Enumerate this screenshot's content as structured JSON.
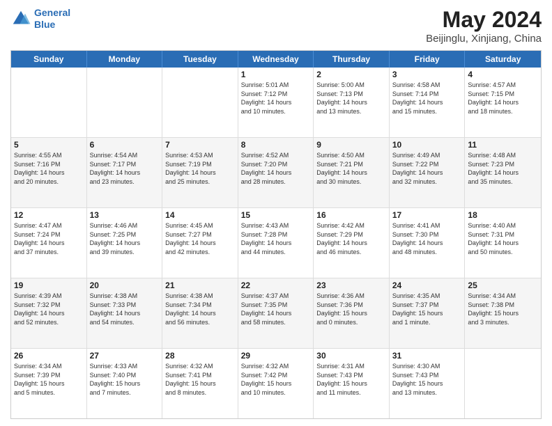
{
  "header": {
    "logo_line1": "General",
    "logo_line2": "Blue",
    "title": "May 2024",
    "subtitle": "Beijinglu, Xinjiang, China"
  },
  "days": [
    "Sunday",
    "Monday",
    "Tuesday",
    "Wednesday",
    "Thursday",
    "Friday",
    "Saturday"
  ],
  "rows": [
    [
      {
        "num": "",
        "lines": []
      },
      {
        "num": "",
        "lines": []
      },
      {
        "num": "",
        "lines": []
      },
      {
        "num": "1",
        "lines": [
          "Sunrise: 5:01 AM",
          "Sunset: 7:12 PM",
          "Daylight: 14 hours",
          "and 10 minutes."
        ]
      },
      {
        "num": "2",
        "lines": [
          "Sunrise: 5:00 AM",
          "Sunset: 7:13 PM",
          "Daylight: 14 hours",
          "and 13 minutes."
        ]
      },
      {
        "num": "3",
        "lines": [
          "Sunrise: 4:58 AM",
          "Sunset: 7:14 PM",
          "Daylight: 14 hours",
          "and 15 minutes."
        ]
      },
      {
        "num": "4",
        "lines": [
          "Sunrise: 4:57 AM",
          "Sunset: 7:15 PM",
          "Daylight: 14 hours",
          "and 18 minutes."
        ]
      }
    ],
    [
      {
        "num": "5",
        "lines": [
          "Sunrise: 4:55 AM",
          "Sunset: 7:16 PM",
          "Daylight: 14 hours",
          "and 20 minutes."
        ]
      },
      {
        "num": "6",
        "lines": [
          "Sunrise: 4:54 AM",
          "Sunset: 7:17 PM",
          "Daylight: 14 hours",
          "and 23 minutes."
        ]
      },
      {
        "num": "7",
        "lines": [
          "Sunrise: 4:53 AM",
          "Sunset: 7:19 PM",
          "Daylight: 14 hours",
          "and 25 minutes."
        ]
      },
      {
        "num": "8",
        "lines": [
          "Sunrise: 4:52 AM",
          "Sunset: 7:20 PM",
          "Daylight: 14 hours",
          "and 28 minutes."
        ]
      },
      {
        "num": "9",
        "lines": [
          "Sunrise: 4:50 AM",
          "Sunset: 7:21 PM",
          "Daylight: 14 hours",
          "and 30 minutes."
        ]
      },
      {
        "num": "10",
        "lines": [
          "Sunrise: 4:49 AM",
          "Sunset: 7:22 PM",
          "Daylight: 14 hours",
          "and 32 minutes."
        ]
      },
      {
        "num": "11",
        "lines": [
          "Sunrise: 4:48 AM",
          "Sunset: 7:23 PM",
          "Daylight: 14 hours",
          "and 35 minutes."
        ]
      }
    ],
    [
      {
        "num": "12",
        "lines": [
          "Sunrise: 4:47 AM",
          "Sunset: 7:24 PM",
          "Daylight: 14 hours",
          "and 37 minutes."
        ]
      },
      {
        "num": "13",
        "lines": [
          "Sunrise: 4:46 AM",
          "Sunset: 7:25 PM",
          "Daylight: 14 hours",
          "and 39 minutes."
        ]
      },
      {
        "num": "14",
        "lines": [
          "Sunrise: 4:45 AM",
          "Sunset: 7:27 PM",
          "Daylight: 14 hours",
          "and 42 minutes."
        ]
      },
      {
        "num": "15",
        "lines": [
          "Sunrise: 4:43 AM",
          "Sunset: 7:28 PM",
          "Daylight: 14 hours",
          "and 44 minutes."
        ]
      },
      {
        "num": "16",
        "lines": [
          "Sunrise: 4:42 AM",
          "Sunset: 7:29 PM",
          "Daylight: 14 hours",
          "and 46 minutes."
        ]
      },
      {
        "num": "17",
        "lines": [
          "Sunrise: 4:41 AM",
          "Sunset: 7:30 PM",
          "Daylight: 14 hours",
          "and 48 minutes."
        ]
      },
      {
        "num": "18",
        "lines": [
          "Sunrise: 4:40 AM",
          "Sunset: 7:31 PM",
          "Daylight: 14 hours",
          "and 50 minutes."
        ]
      }
    ],
    [
      {
        "num": "19",
        "lines": [
          "Sunrise: 4:39 AM",
          "Sunset: 7:32 PM",
          "Daylight: 14 hours",
          "and 52 minutes."
        ]
      },
      {
        "num": "20",
        "lines": [
          "Sunrise: 4:38 AM",
          "Sunset: 7:33 PM",
          "Daylight: 14 hours",
          "and 54 minutes."
        ]
      },
      {
        "num": "21",
        "lines": [
          "Sunrise: 4:38 AM",
          "Sunset: 7:34 PM",
          "Daylight: 14 hours",
          "and 56 minutes."
        ]
      },
      {
        "num": "22",
        "lines": [
          "Sunrise: 4:37 AM",
          "Sunset: 7:35 PM",
          "Daylight: 14 hours",
          "and 58 minutes."
        ]
      },
      {
        "num": "23",
        "lines": [
          "Sunrise: 4:36 AM",
          "Sunset: 7:36 PM",
          "Daylight: 15 hours",
          "and 0 minutes."
        ]
      },
      {
        "num": "24",
        "lines": [
          "Sunrise: 4:35 AM",
          "Sunset: 7:37 PM",
          "Daylight: 15 hours",
          "and 1 minute."
        ]
      },
      {
        "num": "25",
        "lines": [
          "Sunrise: 4:34 AM",
          "Sunset: 7:38 PM",
          "Daylight: 15 hours",
          "and 3 minutes."
        ]
      }
    ],
    [
      {
        "num": "26",
        "lines": [
          "Sunrise: 4:34 AM",
          "Sunset: 7:39 PM",
          "Daylight: 15 hours",
          "and 5 minutes."
        ]
      },
      {
        "num": "27",
        "lines": [
          "Sunrise: 4:33 AM",
          "Sunset: 7:40 PM",
          "Daylight: 15 hours",
          "and 7 minutes."
        ]
      },
      {
        "num": "28",
        "lines": [
          "Sunrise: 4:32 AM",
          "Sunset: 7:41 PM",
          "Daylight: 15 hours",
          "and 8 minutes."
        ]
      },
      {
        "num": "29",
        "lines": [
          "Sunrise: 4:32 AM",
          "Sunset: 7:42 PM",
          "Daylight: 15 hours",
          "and 10 minutes."
        ]
      },
      {
        "num": "30",
        "lines": [
          "Sunrise: 4:31 AM",
          "Sunset: 7:43 PM",
          "Daylight: 15 hours",
          "and 11 minutes."
        ]
      },
      {
        "num": "31",
        "lines": [
          "Sunrise: 4:30 AM",
          "Sunset: 7:43 PM",
          "Daylight: 15 hours",
          "and 13 minutes."
        ]
      },
      {
        "num": "",
        "lines": []
      }
    ]
  ]
}
